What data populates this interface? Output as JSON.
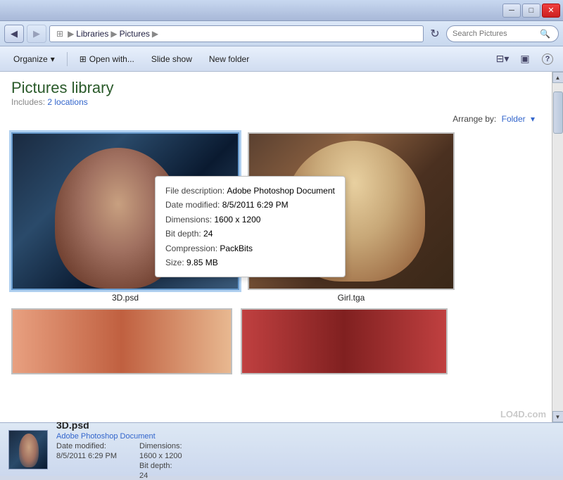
{
  "titlebar": {
    "minimize_label": "─",
    "maximize_label": "□",
    "close_label": "✕"
  },
  "addressbar": {
    "back_icon": "◀",
    "forward_icon": "▶",
    "path": {
      "library": "Libraries",
      "folder": "Pictures"
    },
    "refresh_icon": "↻",
    "search_placeholder": "Search Pictures",
    "search_icon": "🔍"
  },
  "toolbar": {
    "organize_label": "Organize",
    "organize_arrow": "▾",
    "open_with_icon": "⊞",
    "open_with_label": "Open with...",
    "slideshow_label": "Slide show",
    "new_folder_label": "New folder",
    "views_icon": "⊟",
    "views_arrow": "▾",
    "preview_icon": "▣",
    "help_icon": "?"
  },
  "content": {
    "title": "Pictures library",
    "includes_label": "Includes:",
    "locations_label": "2 locations",
    "arrange_label": "Arrange by:",
    "arrange_value": "Folder",
    "arrange_arrow": "▾"
  },
  "files": [
    {
      "name": "3D.psd",
      "type": "large"
    },
    {
      "name": "Girl.tga",
      "type": "large"
    }
  ],
  "tooltip": {
    "file_desc_label": "File description:",
    "file_desc_value": "Adobe Photoshop Document",
    "date_label": "Date modified:",
    "date_value": "8/5/2011 6:29 PM",
    "dimensions_label": "Dimensions:",
    "dimensions_value": "1600 x 1200",
    "bitdepth_label": "Bit depth:",
    "bitdepth_value": "24",
    "compression_label": "Compression:",
    "compression_value": "PackBits",
    "size_label": "Size:",
    "size_value": "9.85 MB"
  },
  "details": {
    "filename": "3D.psd",
    "type": "Adobe Photoshop Document",
    "date_label": "Date modified:",
    "date_value": "8/5/2011 6:29 PM",
    "dimensions_label": "Dimensions:",
    "dimensions_value": "1600 x 1200",
    "bitdepth_label": "Bit depth:",
    "bitdepth_value": "24"
  },
  "watermark": "LO4D.com"
}
